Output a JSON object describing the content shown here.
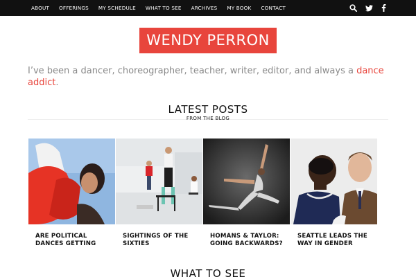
{
  "nav": {
    "links": [
      "ABOUT",
      "OFFERINGS",
      "MY SCHEDULE",
      "WHAT TO SEE",
      "ARCHIVES",
      "MY BOOK",
      "CONTACT"
    ],
    "icons": [
      "search-icon",
      "twitter-icon",
      "facebook-icon"
    ]
  },
  "site": {
    "logo": "WENDY PERRON",
    "tagline_main": "I’ve been a dancer, choreographer, teacher, writer, editor, and always a",
    "tagline_accent": "dance addict",
    "tagline_end": "."
  },
  "latest": {
    "title": "LATEST POSTS",
    "subtitle": "FROM THE BLOG",
    "posts": [
      {
        "title": "ARE POLITICAL DANCES GETTING"
      },
      {
        "title": "SIGHTINGS OF THE SIXTIES"
      },
      {
        "title": "HOMANS & TAYLOR: GOING BACKWARDS?"
      },
      {
        "title": "SEATTLE LEADS THE WAY IN GENDER"
      }
    ]
  },
  "what_to_see": {
    "title": "WHAT TO SEE"
  },
  "colors": {
    "nav_bg": "#111111",
    "accent": "#e8453c",
    "tagline": "#8a8a8a"
  }
}
